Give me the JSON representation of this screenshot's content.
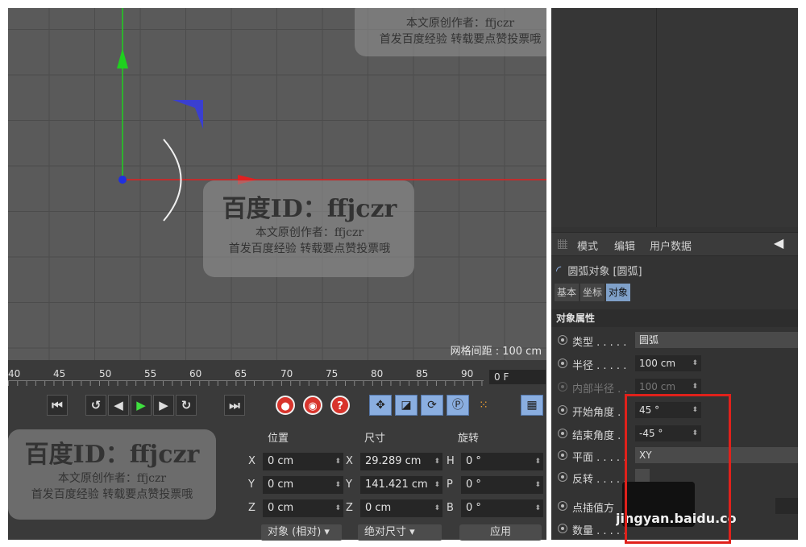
{
  "viewport": {
    "grid_spacing": "网格间距 : 100 cm"
  },
  "timeline": {
    "ticks": [
      "40",
      "45",
      "50",
      "55",
      "60",
      "65",
      "70",
      "75",
      "80",
      "85",
      "90"
    ],
    "frame": "0 F"
  },
  "transport": {
    "buttons": [
      "first-frame",
      "prev-key",
      "prev-frame",
      "play",
      "next-frame",
      "next-key",
      "last-frame"
    ],
    "record_buttons": [
      "record",
      "auto-key",
      "key-help"
    ],
    "tools": [
      "move",
      "scale",
      "rotate",
      "parameter",
      "points",
      "film"
    ]
  },
  "coordinates": {
    "headers": {
      "position": "位置",
      "size": "尺寸",
      "rotation": "旋转"
    },
    "rows": [
      {
        "axis": "X",
        "position": "0 cm",
        "size_axis": "X",
        "size": "29.289 cm",
        "rot_axis": "H",
        "rotation": "0 °"
      },
      {
        "axis": "Y",
        "position": "0 cm",
        "size_axis": "Y",
        "size": "141.421 cm",
        "rot_axis": "P",
        "rotation": "0 °"
      },
      {
        "axis": "Z",
        "position": "0 cm",
        "size_axis": "Z",
        "size": "0 cm",
        "rot_axis": "B",
        "rotation": "0 °"
      }
    ],
    "mode_dropdown": "对象 (相对)",
    "size_dropdown": "绝对尺寸",
    "apply": "应用"
  },
  "attributes": {
    "menu": {
      "mode": "模式",
      "edit": "编辑",
      "user_data": "用户数据"
    },
    "object_header": "圆弧对象 [圆弧]",
    "tabs": [
      "基本",
      "坐标",
      "对象"
    ],
    "active_tab": "对象",
    "section": "对象属性",
    "props": [
      {
        "label": "类型 . . . . .",
        "value": "圆弧"
      },
      {
        "label": "半径 . . . . .",
        "value": "100 cm"
      },
      {
        "label": "内部半径 . .",
        "value": "100 cm"
      },
      {
        "label": "开始角度 .",
        "value": "45 °"
      },
      {
        "label": "结束角度 .",
        "value": "-45 °"
      },
      {
        "label": "平面 . . . . .",
        "value": "XY"
      },
      {
        "label": "反转 . . . . .",
        "value": ""
      },
      {
        "label": "点插值方",
        "value": ""
      },
      {
        "label": "数量 . . . . .",
        "value": ""
      }
    ]
  },
  "watermarks": {
    "id": "百度ID：ffjczr",
    "author": "本文原创作者：ffjczr",
    "note": "首发百度经验  转载要点赞投票哦",
    "corner": "jingyan.baidu.com"
  },
  "colors": {
    "highlight": "#e0211b",
    "x_axis": "#e02020",
    "y_axis": "#20c020",
    "active_tab": "#7fa0c8"
  }
}
